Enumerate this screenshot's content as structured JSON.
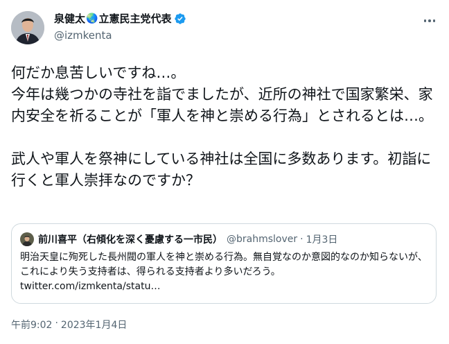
{
  "author": {
    "name_part1": "泉健太",
    "globe_icon": "🌏",
    "name_part2": "立憲民主党代表",
    "verified_icon": "verified-badge-icon",
    "handle": "@izmkenta"
  },
  "tweet": {
    "text": "何だか息苦しいですね…。\n今年は幾つかの寺社を詣でましたが、近所の神社で国家繁栄、家内安全を祈ることが「軍人を神と崇める行為」とされるとは…。\n\n武人や軍人を祭神にしている神社は全国に多数あります。初詣に行くと軍人崇拝なのですか？",
    "time": "午前9:02",
    "separator": "·",
    "date": "2023年1月4日"
  },
  "quoted": {
    "name": "前川喜平（右傾化を深く憂慮する一市民）",
    "handle": "@brahmslover",
    "separator": "·",
    "date": "1月3日",
    "text": "明治天皇に殉死した長州閥の軍人を神と崇める行為。無自覚なのか意図的なのか知らないが、これにより失う支持者は、得られる支持者より多いだろう。\ntwitter.com/izmkenta/statu…"
  },
  "colors": {
    "verified": "#1d9bf0",
    "secondary_text": "#536471",
    "border": "#cfd9de"
  }
}
